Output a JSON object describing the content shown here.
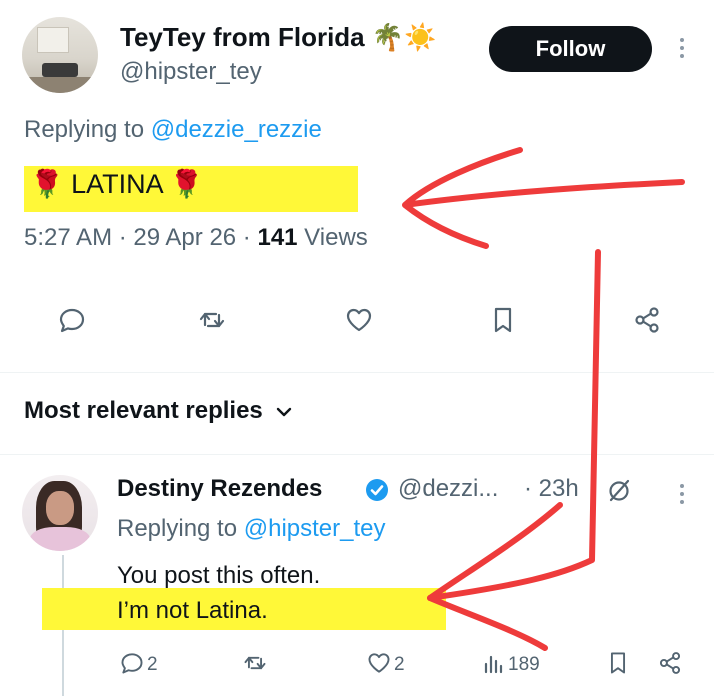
{
  "tweet": {
    "author_name": "TeyTey from Florida 🌴☀️",
    "author_handle": "@hipster_tey",
    "follow_label": "Follow",
    "replying_prefix": "Replying to ",
    "replying_handle": "@dezzie_rezzie",
    "text": "🌹 LATINA 🌹",
    "time": "5:27 AM · 29 Apr 26 · ",
    "views_count": "141",
    "views_label": " Views"
  },
  "replies_sort": "Most relevant replies",
  "reply": {
    "author_name": "Destiny Rezendes",
    "author_handle": "@dezzi...",
    "time": "· 23h",
    "replying_prefix": "Replying to ",
    "replying_handle": "@hipster_tey",
    "line1": "You post this often.",
    "line2": "I’m not Latina.",
    "reply_count": "2",
    "like_count": "2",
    "views_count": "189"
  },
  "colors": {
    "accent": "#1d9bf0",
    "highlight": "#fff838",
    "annotation": "#ee3b3b",
    "verified": "#1d9bf0"
  },
  "icons": [
    "reply-icon",
    "retweet-icon",
    "like-icon",
    "bookmark-icon",
    "share-icon",
    "more-icon",
    "chevron-down-icon",
    "verified-badge-icon",
    "grok-icon",
    "views-icon"
  ]
}
